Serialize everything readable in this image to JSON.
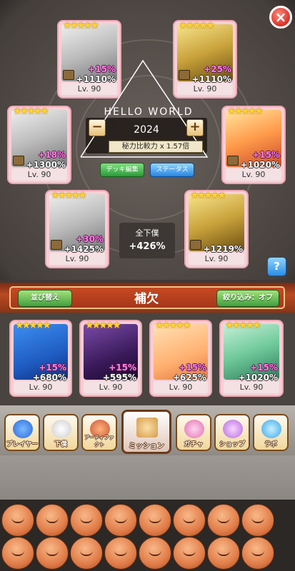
{
  "window": {
    "close_label": "×"
  },
  "overlay": {
    "text": "HELLO WORLD",
    "counter": "2024",
    "minus": "−",
    "plus": "+",
    "power_text": "秘力比較力 x 1.57倍"
  },
  "deck": {
    "edit_label": "デッキ編集",
    "status_label": "ステータス"
  },
  "summary": {
    "title": "全下僕",
    "value": "+426%"
  },
  "help_label": "?",
  "top_cards": [
    {
      "stat1": "+15%",
      "stat2": "+1110%",
      "level": "Lv. 90"
    },
    {
      "stat1": "+25%",
      "stat2": "+1110%",
      "level": "Lv. 90"
    },
    {
      "stat1": "+18%",
      "stat2": "+1300%",
      "level": "Lv. 90"
    },
    {
      "stat1": "+15%",
      "stat2": "+1020%",
      "level": "Lv. 90"
    },
    {
      "stat1": "+30%",
      "stat2": "+1425%",
      "level": "Lv. 90"
    },
    {
      "stat1": "",
      "stat2": "+1219%",
      "level": "Lv. 90"
    }
  ],
  "reserve": {
    "title": "補欠",
    "sort_label": "並び替え",
    "filter_label": "絞り込み：オフ",
    "cards": [
      {
        "stat1": "+15%",
        "stat2": "+680%",
        "level": "Lv. 90"
      },
      {
        "stat1": "+15%",
        "stat2": "+595%",
        "level": "Lv. 90"
      },
      {
        "stat1": "+15%",
        "stat2": "+625%",
        "level": "Lv. 90"
      },
      {
        "stat1": "+15%",
        "stat2": "+1020%",
        "level": "Lv. 90"
      }
    ]
  },
  "nav": {
    "player": "プレイヤー",
    "servants": "下僕",
    "artifact": "アーティファクト",
    "mission": "ミッション",
    "gacha": "ガチャ",
    "shop": "ショップ",
    "lab": "ラボ"
  },
  "colors": {
    "accent": "#b84a22",
    "pink_stat": "#ff7fe1",
    "card_bg": "#f6cfd5"
  }
}
